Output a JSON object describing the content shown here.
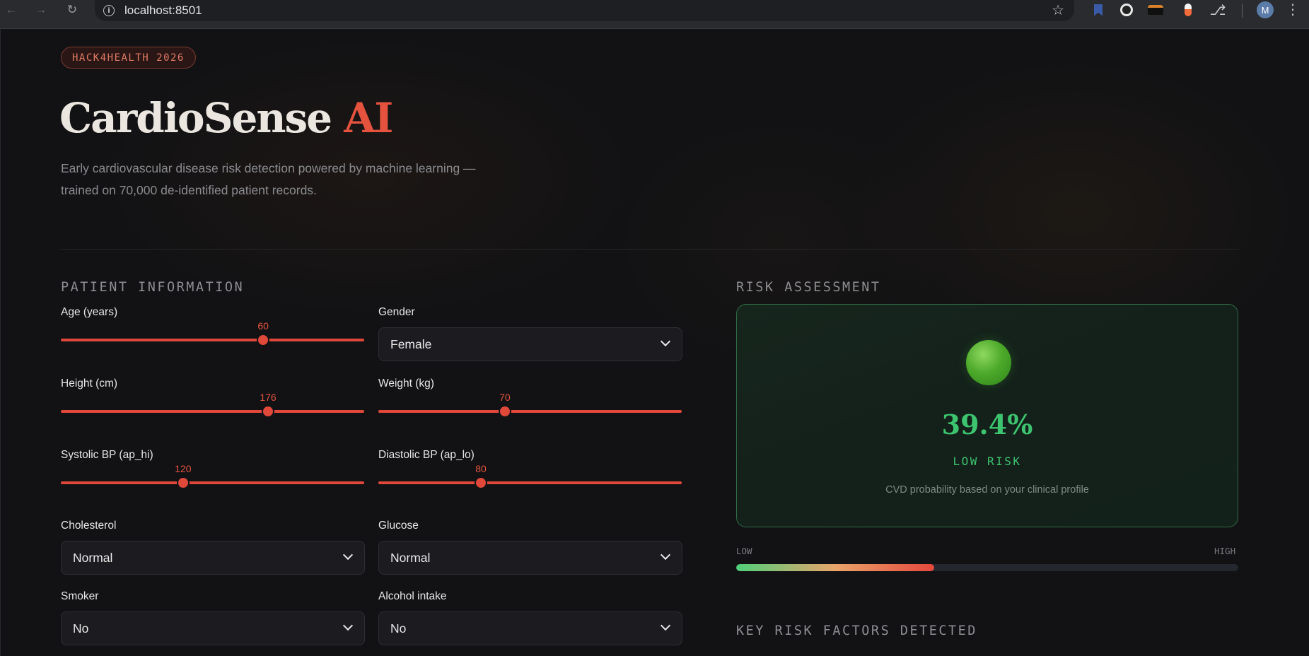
{
  "browser": {
    "url": "localhost:8501",
    "avatar_initial": "M"
  },
  "header": {
    "badge": "HACK4HEALTH 2026",
    "title_main": "CardioSense",
    "title_accent": "AI",
    "subtitle_line1": "Early cardiovascular disease risk detection powered by machine learning —",
    "subtitle_line2": "trained on 70,000 de-identified patient records."
  },
  "patient": {
    "section_title": "PATIENT INFORMATION",
    "age": {
      "label": "Age (years)",
      "value": "60",
      "fraction": 0.667
    },
    "gender": {
      "label": "Gender",
      "value": "Female"
    },
    "height": {
      "label": "Height (cm)",
      "value": "176",
      "fraction": 0.683
    },
    "weight": {
      "label": "Weight (kg)",
      "value": "70",
      "fraction": 0.417
    },
    "systolic": {
      "label": "Systolic BP (ap_hi)",
      "value": "120",
      "fraction": 0.403
    },
    "diastolic": {
      "label": "Diastolic BP (ap_lo)",
      "value": "80",
      "fraction": 0.338
    },
    "cholesterol": {
      "label": "Cholesterol",
      "value": "Normal"
    },
    "glucose": {
      "label": "Glucose",
      "value": "Normal"
    },
    "smoker": {
      "label": "Smoker",
      "value": "No"
    },
    "alcohol": {
      "label": "Alcohol intake",
      "value": "No"
    }
  },
  "risk": {
    "section_title": "RISK ASSESSMENT",
    "percent": "39.4%",
    "probability": 0.394,
    "level": "LOW RISK",
    "description": "CVD probability based on your clinical profile",
    "gauge_low": "LOW",
    "gauge_high": "HIGH",
    "accent_color": "#3cc46f"
  },
  "factors": {
    "section_title": "KEY RISK FACTORS DETECTED"
  },
  "colors": {
    "brand_red": "#e5533f",
    "background": "#121214"
  }
}
